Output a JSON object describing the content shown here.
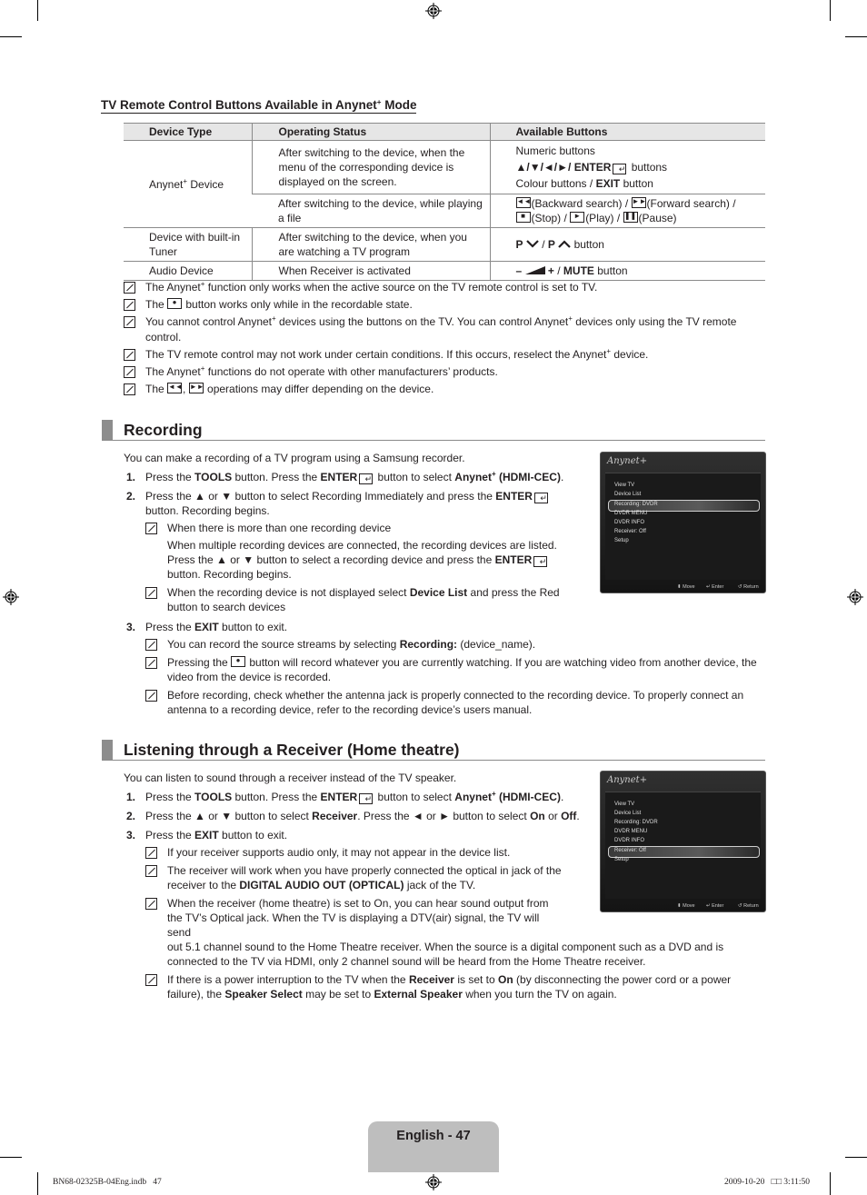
{
  "table_section": {
    "title": "TV Remote Control Buttons Available in Anynet",
    "title_sup": "+",
    "title_end": " Mode",
    "headers": [
      "Device Type",
      "Operating Status",
      "Available Buttons"
    ],
    "rows": [
      {
        "device": "Anynet",
        "device_sup": "+",
        "device_end": " Device",
        "status_1": "After switching to the device, when the menu of the corresponding device is displayed on the screen.",
        "buttons_1_line1": "Numeric buttons",
        "buttons_1_arrows": "▲/▼/◄/►/ ",
        "buttons_1_enter": "ENTER",
        "buttons_1_after": " buttons",
        "buttons_1_line3a": "Colour buttons / ",
        "buttons_1_exit": "EXIT",
        "buttons_1_line3b": " button",
        "status_2": "After switching to the device, while playing a file",
        "buttons_2_rew": "(Backward search) / ",
        "buttons_2_ff": "(Forward search) /",
        "buttons_2_stop": "(Stop) / ",
        "buttons_2_play": "(Play) / ",
        "buttons_2_pause": "(Pause)"
      },
      {
        "device": "Device with built-in Tuner",
        "status": "After switching to the device, when you are watching a TV program",
        "buttons_p1": "P",
        "buttons_sep": " / ",
        "buttons_p2": "P",
        "buttons_end": " button"
      },
      {
        "device": "Audio Device",
        "status": "When Receiver is activated",
        "buttons_vol": "–",
        "buttons_plus": "+",
        "buttons_sep": " / ",
        "buttons_mute": "MUTE",
        "buttons_end": " button"
      }
    ],
    "notes": [
      {
        "a": "The Anynet",
        "sup": "+",
        "b": " function only works when the active source on the TV remote control is set to TV."
      },
      {
        "a": "The ",
        "b": " button works only while in the recordable state."
      },
      {
        "a": "You cannot control Anynet",
        "sup": "+",
        "b": " devices using the buttons on the TV. You can control Anynet",
        "sup2": "+",
        "c": " devices only using the TV remote control."
      },
      {
        "a": "The TV remote control may not work under certain conditions. If this occurs, reselect the Anynet",
        "sup": "+",
        "b": " device."
      },
      {
        "a": "The Anynet",
        "sup": "+",
        "b": " functions do not operate with other manufacturers’ products."
      },
      {
        "a": "The ",
        "mid": ", ",
        "b": " operations may differ depending on the device."
      }
    ]
  },
  "recording": {
    "heading": "Recording",
    "intro": "You can make a recording of a TV program using a Samsung recorder.",
    "step1": {
      "num": "1.",
      "a": "Press the ",
      "tools": "TOOLS",
      "b": " button. Press the ",
      "enter": "ENTER",
      "c": " button to select ",
      "anynet": "Anynet",
      "sup": "+",
      "hdmi": " (HDMI-CEC)",
      "d": "."
    },
    "step2": {
      "num": "2.",
      "a": "Press the ▲ or ▼ button to select Recording Immediately and press the ",
      "enter": "ENTER",
      "b": " button. Recording begins."
    },
    "step2_note1_title": "When there is more than one recording device",
    "step2_note1_body_a": "When multiple recording devices are connected, the recording devices are listed. Press the ▲ or ▼ button to select a recording device and press the ",
    "step2_note1_enter": "ENTER",
    "step2_note1_body_b": " button. Recording begins.",
    "step2_note2_a": "When the recording device is not displayed select ",
    "step2_note2_bold": "Device List",
    "step2_note2_b": " and press the Red button to search devices",
    "step3": {
      "num": "3.",
      "a": "Press the ",
      "exit": "EXIT",
      "b": " button to exit."
    },
    "step3_notes": [
      {
        "a": "You can record the source streams by selecting ",
        "bold": "Recording:",
        "b": " (device_name)."
      },
      {
        "a": "Pressing the ",
        "b": " button will record whatever you are currently watching. If you are watching video from another device, the video from the device is recorded."
      },
      {
        "a": "Before recording, check whether the antenna jack is properly connected to the recording device. To properly connect an antenna to a recording device, refer to the recording device’s users manual."
      }
    ],
    "osd": {
      "logo": "Anynet+",
      "items": [
        "View TV",
        "Device List",
        "Recording: DVDR",
        "DVDR MENU",
        "DVDR INFO",
        "Receiver: Off",
        "Setup"
      ],
      "selected": "Recording: DVDR",
      "footer": [
        "Move",
        "Enter",
        "Return"
      ]
    }
  },
  "receiver": {
    "heading": "Listening through a Receiver (Home theatre)",
    "intro": "You can listen to sound through a receiver instead of the TV speaker.",
    "step1": {
      "num": "1.",
      "a": "Press the ",
      "tools": "TOOLS",
      "b": " button. Press the ",
      "enter": "ENTER",
      "c": " button to select ",
      "anynet": "Anynet",
      "sup": "+",
      "hdmi": " (HDMI-CEC)",
      "d": "."
    },
    "step2": {
      "num": "2.",
      "a": "Press the ▲ or ▼ button to select ",
      "receiver": "Receiver",
      "b": ". Press the ◄ or ► button to select ",
      "on": "On",
      "c": " or ",
      "off": "Off",
      "d": "."
    },
    "step3": {
      "num": "3.",
      "a": "Press the ",
      "exit": "EXIT",
      "b": " button to exit."
    },
    "notes": [
      {
        "a": "If your receiver supports audio only, it may not appear in the device list."
      },
      {
        "a": "The receiver will work when you have properly connected the optical in jack of the receiver to the ",
        "bold": "DIGITAL AUDIO OUT (OPTICAL)",
        "b": " jack of the TV."
      },
      {
        "a": "When the receiver (home theatre) is set to On, you can hear sound output from the TV’s Optical jack. When the TV is displaying a DTV(air) signal, the TV will send",
        "b": "out 5.1 channel sound to the Home Theatre receiver. When the source is a digital component such as a DVD and is connected to the TV via HDMI, only 2 channel sound will be heard from the Home Theatre receiver."
      },
      {
        "a": "If there is a power interruption to the TV when the ",
        "bold1": "Receiver",
        "b": " is set to ",
        "bold2": "On",
        "c": " (by disconnecting the power cord or a power failure), the ",
        "bold3": "Speaker Select",
        "d": " may be set to ",
        "bold4": "External Speaker",
        "e": " when you turn the TV on again."
      }
    ],
    "osd": {
      "logo": "Anynet+",
      "items": [
        "View TV",
        "Device List",
        "Recording: DVDR",
        "DVDR MENU",
        "DVDR INFO",
        "Receiver: Off",
        "Setup"
      ],
      "selected": "Receiver: Off",
      "footer": [
        "Move",
        "Enter",
        "Return"
      ]
    }
  },
  "footer": {
    "page_label": "English - 47",
    "file": "BN68-02325B-04Eng.indb   47",
    "date": "2009-10-20   □□ 3:11:50"
  }
}
